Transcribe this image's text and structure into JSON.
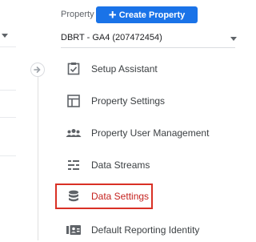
{
  "header": {
    "property_label": "Property",
    "create_button_label": "Create Property",
    "create_button_icon": "plus-icon",
    "property_value": "DBRT - GA4 (207472454)"
  },
  "menu": {
    "items": [
      {
        "label": "Setup Assistant",
        "icon": "checklist-icon"
      },
      {
        "label": "Property Settings",
        "icon": "layout-icon"
      },
      {
        "label": "Property User Management",
        "icon": "people-icon"
      },
      {
        "label": "Data Streams",
        "icon": "streams-icon"
      },
      {
        "label": "Data Settings",
        "icon": "database-icon",
        "active": true
      },
      {
        "label": "Default Reporting Identity",
        "icon": "id-card-icon"
      }
    ]
  },
  "colors": {
    "accent": "#1a73e8",
    "active_text": "#c5221f",
    "highlight_border": "#d93025",
    "icon": "#5f6368"
  }
}
